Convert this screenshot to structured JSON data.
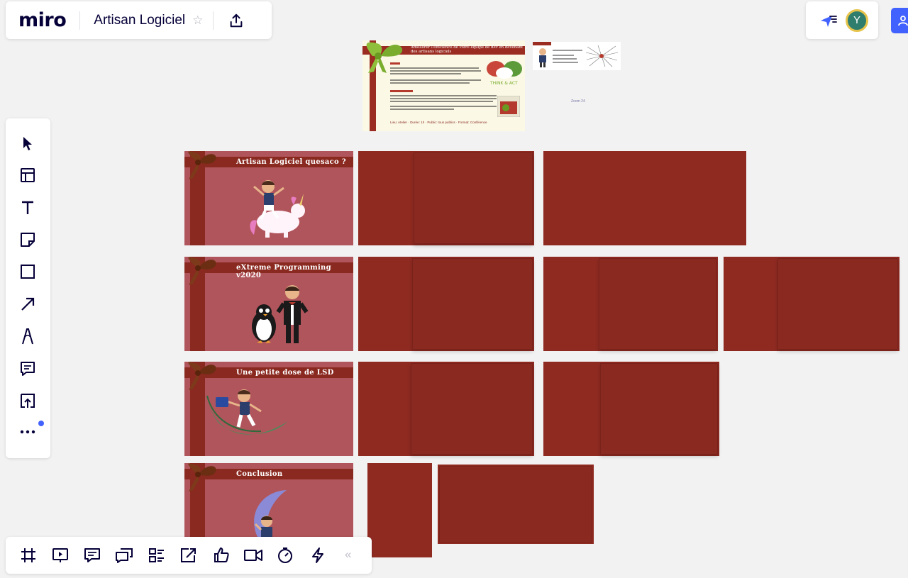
{
  "header": {
    "logo": "miro",
    "board_title": "Artisan Logiciel"
  },
  "topright": {
    "avatar_initial": "Y"
  },
  "toolbar": {
    "tools": [
      "select",
      "templates",
      "text",
      "sticky-note",
      "shape",
      "connection-line",
      "pen",
      "comment",
      "upload",
      "more"
    ]
  },
  "bottombar": {
    "tools": [
      "frames",
      "presentation",
      "comments",
      "chat",
      "card",
      "share-screen",
      "voting",
      "video-chat",
      "timer",
      "activity"
    ]
  },
  "canvas": {
    "doc_card": {
      "title": "Améliorer l'efficience de votre équipe de dev en devenant des artisans logiciels",
      "footer": "Lieu: Atelier  ·  Durée: 1h  ·  Public: tous publics  ·  Format: Conférence"
    },
    "slides": [
      {
        "title": "Artisan Logiciel quesaco ?"
      },
      {
        "title": "eXtreme Programming v2020"
      },
      {
        "title": "Une petite dose de LSD"
      },
      {
        "title": "Conclusion"
      }
    ],
    "tiny_label": "Zoom 24"
  },
  "colors": {
    "frame": "#8f2a21",
    "slide": "#b0555b",
    "accent": "#4262ff",
    "avatar_bg": "#2f7d6d",
    "avatar_ring": "#e6c34a"
  }
}
